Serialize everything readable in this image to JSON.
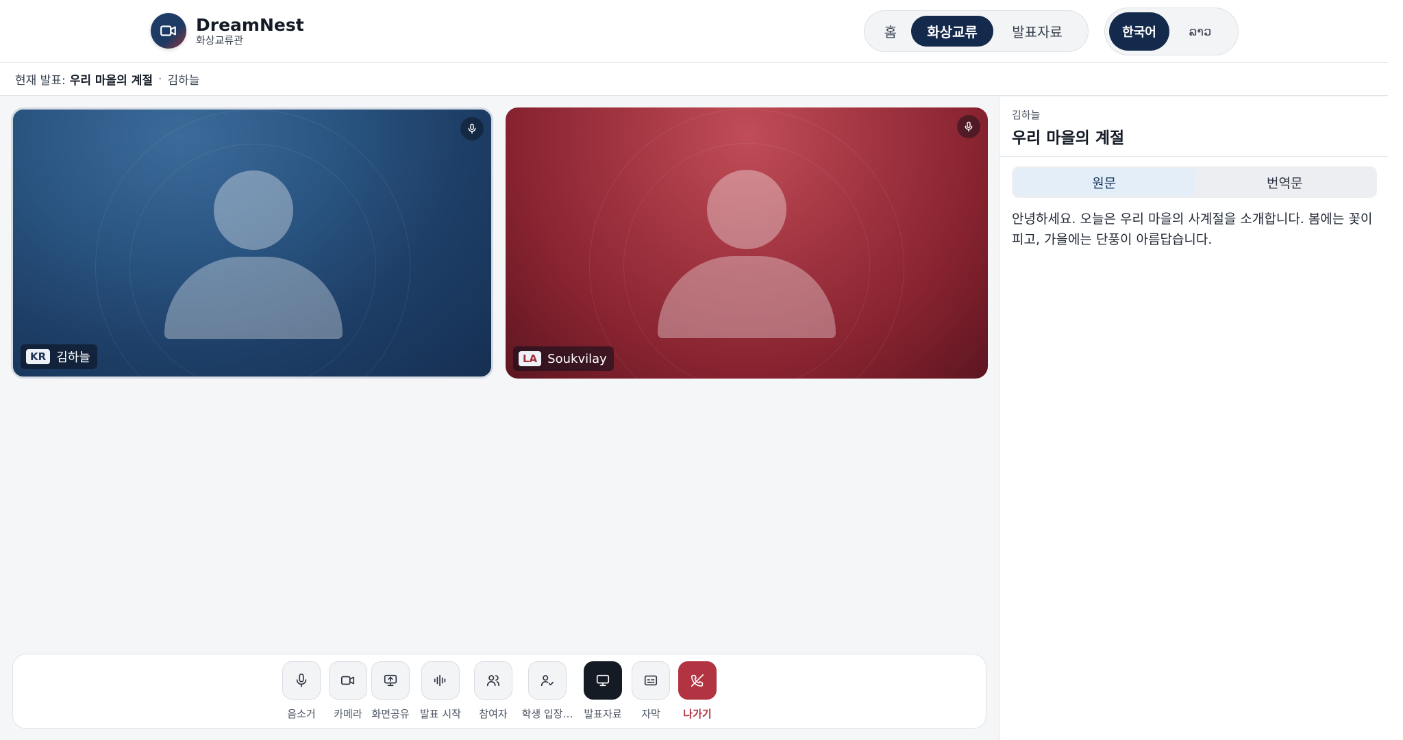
{
  "header": {
    "brand_name": "DreamNest",
    "brand_sub": "화상교류관",
    "nav": {
      "home": "홈",
      "video": "화상교류",
      "docs": "발표자료"
    },
    "lang": {
      "ko": "한국어",
      "lo": "ລາວ"
    }
  },
  "subbar": {
    "prefix": "현재 발표:",
    "title": "우리 마을의 계절",
    "separator": "·",
    "presenter": "김하늘"
  },
  "tiles": {
    "kr": {
      "code": "KR",
      "name": "김하늘"
    },
    "la": {
      "code": "LA",
      "name": "Soukvilay"
    }
  },
  "controls": {
    "mute": "음소거",
    "camera": "카메라",
    "share": "화면공유",
    "present": "발표 시작",
    "participants": "참여자",
    "admission": "학생 입장…",
    "slides": "발표자료",
    "captions": "자막",
    "leave": "나가기"
  },
  "panel": {
    "presenter": "김하늘",
    "title": "우리 마을의 계절",
    "tab_original": "원문",
    "tab_translation": "번역문",
    "transcript": "안녕하세요. 오늘은 우리 마을의 사계절을 소개합니다. 봄에는 꽃이 피고, 가을에는 단풍이 아름답습니다."
  },
  "colors": {
    "primary_navy": "#142a4c",
    "danger": "#b23341",
    "tile_kr": "#1d3e66",
    "tile_la": "#86222f"
  }
}
